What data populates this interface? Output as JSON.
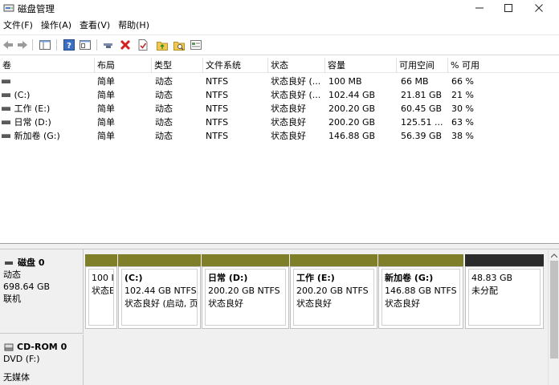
{
  "window": {
    "title": "磁盘管理"
  },
  "menu": [
    "文件(F)",
    "操作(A)",
    "查看(V)",
    "帮助(H)"
  ],
  "table": {
    "columns": [
      "卷",
      "布局",
      "类型",
      "文件系统",
      "状态",
      "容量",
      "可用空间",
      "% 可用"
    ],
    "rows": [
      [
        "",
        "简单",
        "动态",
        "NTFS",
        "状态良好 (...",
        "100 MB",
        "66 MB",
        "66 %"
      ],
      [
        "(C:)",
        "简单",
        "动态",
        "NTFS",
        "状态良好 (...",
        "102.44 GB",
        "21.81 GB",
        "21 %"
      ],
      [
        "工作 (E:)",
        "简单",
        "动态",
        "NTFS",
        "状态良好",
        "200.20 GB",
        "60.45 GB",
        "30 %"
      ],
      [
        "日常 (D:)",
        "简单",
        "动态",
        "NTFS",
        "状态良好",
        "200.20 GB",
        "125.51 ...",
        "63 %"
      ],
      [
        "新加卷 (G:)",
        "简单",
        "动态",
        "NTFS",
        "状态良好",
        "146.88 GB",
        "56.39 GB",
        "38 %"
      ]
    ]
  },
  "disk0": {
    "name": "磁盘 0",
    "type": "动态",
    "size": "698.64 GB",
    "status": "联机",
    "partitions": [
      {
        "name": "",
        "line1": "100 I",
        "line2": "状态E",
        "color": "#7f7f2a"
      },
      {
        "name": "(C:)",
        "line1": "102.44 GB NTFS",
        "line2": "状态良好 (启动, 页",
        "color": "#7f7f2a"
      },
      {
        "name": "日常  (D:)",
        "line1": "200.20 GB NTFS",
        "line2": "状态良好",
        "color": "#7f7f2a"
      },
      {
        "name": "工作  (E:)",
        "line1": "200.20 GB NTFS",
        "line2": "状态良好",
        "color": "#7f7f2a"
      },
      {
        "name": "新加卷  (G:)",
        "line1": "146.88 GB NTFS",
        "line2": "状态良好",
        "color": "#7f7f2a"
      },
      {
        "name": "",
        "line1": "48.83 GB",
        "line2": "未分配",
        "color": "#2b2b2b"
      }
    ]
  },
  "cdrom0": {
    "name": "CD-ROM 0",
    "drive": "DVD (F:)",
    "status": "无媒体"
  }
}
